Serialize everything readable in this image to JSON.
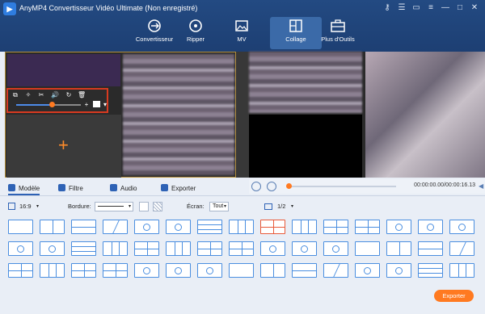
{
  "window": {
    "title": "AnyMP4 Convertisseur Vidéo Ultimate (Non enregistré)"
  },
  "nav": {
    "items": [
      {
        "label": "Convertisseur",
        "icon": "convert-icon"
      },
      {
        "label": "Ripper",
        "icon": "disc-icon"
      },
      {
        "label": "MV",
        "icon": "image-icon"
      },
      {
        "label": "Collage",
        "icon": "collage-icon",
        "active": true
      },
      {
        "label": "Plus d'Outils",
        "icon": "toolbox-icon"
      }
    ]
  },
  "playback": {
    "time": "00:00:00.00/00:00:16.13",
    "progress": 0.0
  },
  "tabs": [
    {
      "label": "Modèle",
      "active": true
    },
    {
      "label": "Filtre"
    },
    {
      "label": "Audio"
    },
    {
      "label": "Exporter"
    }
  ],
  "options": {
    "ratio": "16:9",
    "border_label": "Bordure:",
    "screen_label": "Écran:",
    "screen_value": "Tout",
    "page": "1/2"
  },
  "clip_toolbar": {
    "volume_level": 0.55
  },
  "export_button": "Exporter",
  "colors": {
    "accent": "#ff7a21",
    "primary": "#2e62b5",
    "header": "#1d3f73"
  }
}
